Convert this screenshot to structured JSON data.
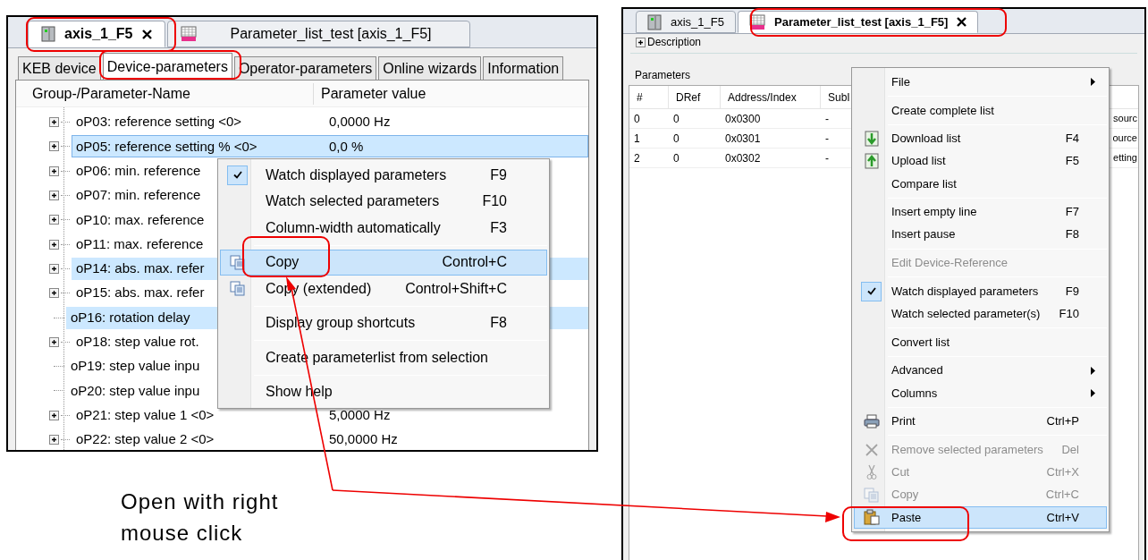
{
  "left_window": {
    "file_tabs": [
      {
        "label": "axis_1_F5",
        "kind": "device",
        "selected": true
      },
      {
        "label": "Parameter_list_test [axis_1_F5]",
        "kind": "list",
        "selected": false
      }
    ],
    "tabs": [
      {
        "label": "KEB device",
        "selected": false
      },
      {
        "label": "Device-parameters",
        "selected": true
      },
      {
        "label": "Operator-parameters",
        "selected": false
      },
      {
        "label": "Online wizards",
        "selected": false
      },
      {
        "label": "Information",
        "selected": false
      }
    ],
    "tree": {
      "columns": [
        "Group-/Parameter-Name",
        "Parameter value"
      ],
      "rows": [
        {
          "name": "oP03: reference setting <0>",
          "value": "0,0000 Hz",
          "expandable": true,
          "selected": false
        },
        {
          "name": "oP05: reference setting % <0>",
          "value": "0,0 %",
          "expandable": true,
          "selected": true
        },
        {
          "name": "oP06: min. reference",
          "expandable": true,
          "selected": false
        },
        {
          "name": "oP07: min. reference",
          "expandable": true,
          "selected": false
        },
        {
          "name": "oP10: max. reference",
          "expandable": true,
          "selected": false
        },
        {
          "name": "oP11: max. reference",
          "expandable": true,
          "selected": false
        },
        {
          "name": "oP14: abs. max. refer",
          "expandable": true,
          "selected": true
        },
        {
          "name": "oP15: abs. max. refer",
          "expandable": true,
          "selected": false
        },
        {
          "name": "oP16: rotation delay",
          "expandable": false,
          "selected": true
        },
        {
          "name": "oP18: step value rot.",
          "expandable": true,
          "selected": false
        },
        {
          "name": "oP19: step value inpu",
          "expandable": false,
          "selected": false
        },
        {
          "name": "oP20: step value inpu",
          "expandable": false,
          "selected": false
        },
        {
          "name": "oP21: step value 1 <0>",
          "value": "5,0000 Hz",
          "expandable": true,
          "selected": false
        },
        {
          "name": "oP22: step value 2 <0>",
          "value": "50,0000 Hz",
          "expandable": true,
          "selected": false
        }
      ]
    },
    "context_menu": {
      "items": [
        {
          "kind": "item",
          "label": "Watch displayed parameters",
          "shortcut": "F9",
          "checked": true,
          "selected": false
        },
        {
          "kind": "item",
          "label": "Watch selected parameters",
          "shortcut": "F10",
          "checked": false,
          "selected": false
        },
        {
          "kind": "item",
          "label": "Column-width automatically",
          "shortcut": "F3",
          "checked": false,
          "selected": false
        },
        {
          "kind": "separator"
        },
        {
          "kind": "copy",
          "label": "Copy",
          "shortcut": "Control+C",
          "checked": false,
          "selected": true
        },
        {
          "kind": "copy",
          "label": "Copy (extended)",
          "shortcut": "Control+Shift+C",
          "checked": false,
          "selected": false
        },
        {
          "kind": "separator"
        },
        {
          "kind": "item",
          "label": "Display group shortcuts",
          "shortcut": "F8",
          "checked": false,
          "selected": false
        },
        {
          "kind": "separator"
        },
        {
          "kind": "item",
          "label": "Create parameterlist from selection",
          "checked": false,
          "selected": false
        },
        {
          "kind": "separator"
        },
        {
          "kind": "item",
          "label": "Show help",
          "checked": false,
          "selected": false
        }
      ]
    }
  },
  "right_window": {
    "file_tabs": [
      {
        "label": "axis_1_F5",
        "kind": "device",
        "selected": false
      },
      {
        "label": "Parameter_list_test [axis_1_F5]",
        "kind": "list",
        "selected": true
      }
    ],
    "description": {
      "label": "Description"
    },
    "parameters": {
      "label": "Parameters",
      "columns": [
        "#",
        "DRef",
        "Address/Index",
        "SubI"
      ],
      "rows": [
        {
          "cells": [
            "0",
            "0",
            "0x0300",
            "-"
          ],
          "column_6": "sourc"
        },
        {
          "cells": [
            "1",
            "0",
            "0x0301",
            "-"
          ],
          "column_6": "ource"
        },
        {
          "cells": [
            "2",
            "0",
            "0x0302",
            "-"
          ],
          "column_6": "etting"
        }
      ]
    },
    "context_menu": {
      "items": [
        {
          "kind": "item",
          "label": "File",
          "submenu": true,
          "disabled": false,
          "checked": false,
          "selected": false
        },
        {
          "kind": "separator"
        },
        {
          "kind": "item",
          "label": "Create complete list",
          "disabled": false,
          "checked": false,
          "selected": false
        },
        {
          "kind": "separator"
        },
        {
          "kind": "download",
          "label": "Download list",
          "shortcut": "F4",
          "disabled": false,
          "checked": false,
          "selected": false
        },
        {
          "kind": "upload",
          "label": "Upload list",
          "shortcut": "F5",
          "disabled": false,
          "checked": false,
          "selected": false
        },
        {
          "kind": "item",
          "label": "Compare list",
          "disabled": false,
          "checked": false,
          "selected": false
        },
        {
          "kind": "separator"
        },
        {
          "kind": "item",
          "label": "Insert empty line",
          "shortcut": "F7",
          "disabled": false,
          "checked": false,
          "selected": false
        },
        {
          "kind": "item",
          "label": "Insert pause",
          "shortcut": "F8",
          "disabled": false,
          "checked": false,
          "selected": false
        },
        {
          "kind": "separator"
        },
        {
          "kind": "item",
          "label": "Edit Device-Reference",
          "disabled": true,
          "checked": false,
          "selected": false
        },
        {
          "kind": "separator"
        },
        {
          "kind": "item",
          "label": "Watch displayed parameters",
          "shortcut": "F9",
          "disabled": false,
          "checked": true,
          "selected": false
        },
        {
          "kind": "item",
          "label": "Watch selected parameter(s)",
          "shortcut": "F10",
          "disabled": false,
          "checked": false,
          "selected": false
        },
        {
          "kind": "separator"
        },
        {
          "kind": "item",
          "label": "Convert list",
          "disabled": false,
          "checked": false,
          "selected": false
        },
        {
          "kind": "separator"
        },
        {
          "kind": "item",
          "label": "Advanced",
          "submenu": true,
          "disabled": false,
          "checked": false,
          "selected": false
        },
        {
          "kind": "item",
          "label": "Columns",
          "submenu": true,
          "disabled": false,
          "checked": false,
          "selected": false
        },
        {
          "kind": "separator"
        },
        {
          "kind": "print",
          "label": "Print",
          "shortcut": "Ctrl+P",
          "disabled": false,
          "checked": false,
          "selected": false
        },
        {
          "kind": "separator"
        },
        {
          "kind": "remove",
          "label": "Remove selected parameters",
          "shortcut": "Del",
          "disabled": true,
          "checked": false,
          "selected": false
        },
        {
          "kind": "cut",
          "label": "Cut",
          "shortcut": "Ctrl+X",
          "disabled": true,
          "checked": false,
          "selected": false
        },
        {
          "kind": "copy",
          "label": "Copy",
          "shortcut": "Ctrl+C",
          "disabled": true,
          "checked": false,
          "selected": false
        },
        {
          "kind": "paste",
          "label": "Paste",
          "shortcut": "Ctrl+V",
          "disabled": false,
          "checked": false,
          "selected": true
        }
      ]
    }
  },
  "annotation": {
    "caption": "Open with right mouse click"
  }
}
